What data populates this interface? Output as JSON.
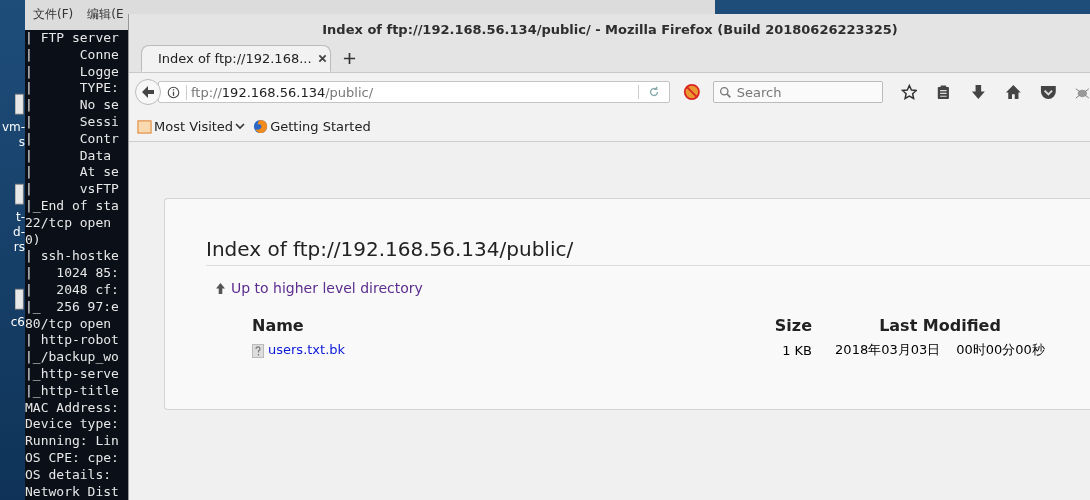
{
  "desktop_icons": [
    {
      "lines": [
        "vm-",
        "s"
      ]
    },
    {
      "lines": [
        "t-",
        "d-",
        "rs"
      ]
    },
    {
      "lines": [
        "c6"
      ]
    }
  ],
  "terminal": {
    "menu": [
      "文件(F)",
      "编辑(E"
    ],
    "lines": [
      "| FTP server",
      "|      Conne",
      "|      Logge",
      "|      TYPE:",
      "|      No se",
      "|      Sessi",
      "|      Contr",
      "|      Data ",
      "|      At se",
      "|      vsFTP",
      "|_End of sta",
      "22/tcp open ",
      "0)",
      "| ssh-hostke",
      "|   1024 85:",
      "|   2048 cf:",
      "|_  256 97:e",
      "80/tcp open ",
      "| http-robot",
      "|_/backup_wo",
      "|_http-serve",
      "|_http-title",
      "MAC Address:",
      "Device type:",
      "Running: Lin",
      "OS CPE: cpe:",
      "OS details: ",
      "Network Dist"
    ]
  },
  "window": {
    "title": "Index of ftp://192.168.56.134/public/ - Mozilla Firefox (Build 20180626223325)"
  },
  "tabs": [
    {
      "label": "Index of ftp://192.168...",
      "selected": true
    }
  ],
  "address_bar": {
    "scheme": "ftp://",
    "host": "192.168.56.134",
    "path": "/public/"
  },
  "search": {
    "placeholder": "Search"
  },
  "bookmarks": [
    {
      "kind": "folder",
      "label": "Most Visited"
    },
    {
      "kind": "page",
      "label": "Getting Started"
    }
  ],
  "page": {
    "heading": "Index of ftp://192.168.56.134/public/",
    "parent_link": "Up to higher level directory",
    "columns": [
      "Name",
      "Size",
      "Last Modified"
    ],
    "rows": [
      {
        "name": "users.txt.bk",
        "size": "1 KB",
        "date": "2018年03月03日",
        "time": "00时00分00秒"
      }
    ]
  }
}
